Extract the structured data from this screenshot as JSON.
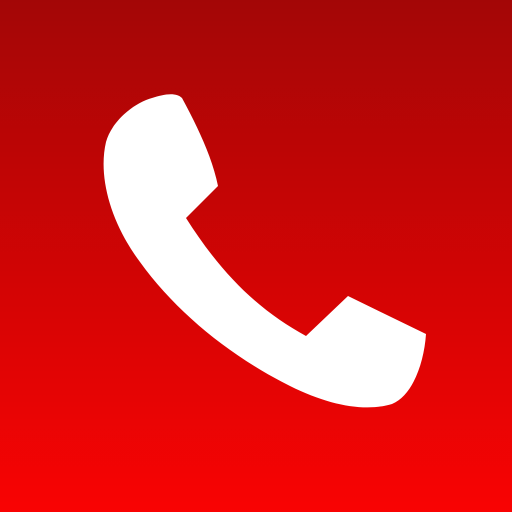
{
  "icon": {
    "name": "phone-icon",
    "background_top_color": "#A30606",
    "background_bottom_color": "#F90303",
    "glyph_color": "#FFFFFF"
  }
}
